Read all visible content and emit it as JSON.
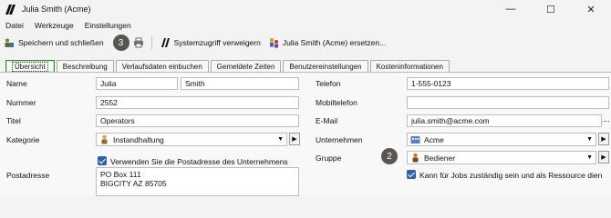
{
  "window": {
    "title": "Julia Smith (Acme)",
    "minimize": "—",
    "maximize": "☐",
    "close": "✕"
  },
  "menu": [
    "Datei",
    "Werkzeuge",
    "Einstellungen"
  ],
  "toolbar": {
    "save_close": "Speichern und schließen",
    "callout_3": "3",
    "deny_access": "Systemzugriff verweigern",
    "replace": "Julia Smith (Acme) ersetzen..."
  },
  "tabs": [
    "Übersicht",
    "Beschreibung",
    "Verlaufsdaten einbuchen",
    "Gemeldete Zeiten",
    "Benutzereinstellungen",
    "Kosteninformationen"
  ],
  "form": {
    "name_label": "Name",
    "first_name": "Julia",
    "last_name": "Smith",
    "number_label": "Nummer",
    "number": "2552",
    "title_label": "Titel",
    "title": "Operators",
    "category_label": "Kategorie",
    "category": "Instandhaltung",
    "use_company_address": "Verwenden Sie die Postadresse des Unternehmens",
    "postal_label": "Postadresse",
    "postal_line1": "PO Box 111",
    "postal_line2": "BIGCITY AZ 85705",
    "phone_label": "Telefon",
    "phone": "1-555-0123",
    "mobile_label": "Mobiltelefon",
    "mobile": "",
    "email_label": "E-Mail",
    "email": "julia.smith@acme.com",
    "company_label": "Unternehmen",
    "company": "Acme",
    "group_label": "Gruppe",
    "group": "Bediener",
    "callout_2": "2",
    "resource_label": "Kann für Jobs zuständig sein und als Ressource dien"
  }
}
